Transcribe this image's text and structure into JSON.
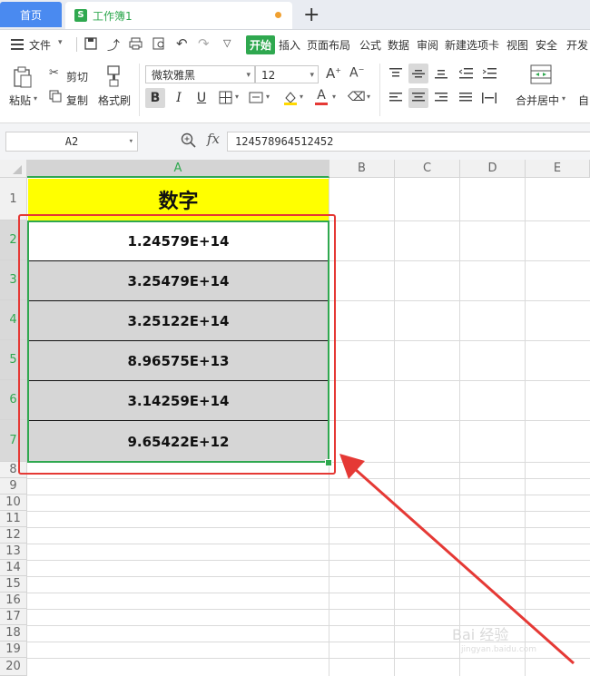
{
  "tabs": {
    "home": "首页",
    "workbook": "工作簿1",
    "new_tab": "+"
  },
  "menu": {
    "file": "文件",
    "items": [
      "开始",
      "插入",
      "页面布局",
      "公式",
      "数据",
      "审阅",
      "新建选项卡",
      "视图",
      "安全",
      "开发"
    ]
  },
  "ribbon": {
    "paste": "粘贴",
    "cut": "剪切",
    "copy": "复制",
    "format_painter": "格式刷",
    "font_name": "微软雅黑",
    "font_size": "12",
    "merge_center": "合并居中",
    "auto_wrap": "自"
  },
  "formula_bar": {
    "cell_ref": "A2",
    "fx": "fx",
    "value": "124578964512452"
  },
  "sheet": {
    "columns": [
      "A",
      "B",
      "C",
      "D",
      "E"
    ],
    "rows": [
      "1",
      "2",
      "3",
      "4",
      "5",
      "6",
      "7",
      "8",
      "9",
      "10",
      "11",
      "12",
      "13",
      "14",
      "15",
      "16",
      "17",
      "18",
      "19",
      "20"
    ],
    "header_cell": "数字",
    "cells": [
      "1.24579E+14",
      "3.25479E+14",
      "3.25122E+14",
      "8.96575E+13",
      "3.14259E+14",
      "9.65422E+12"
    ]
  },
  "watermark": "Bai 经验",
  "watermark_url": "jingyan.baidu.com",
  "colors": {
    "accent": "#2fa84f",
    "header_fill": "#ffff00",
    "annotation": "#e53935"
  }
}
